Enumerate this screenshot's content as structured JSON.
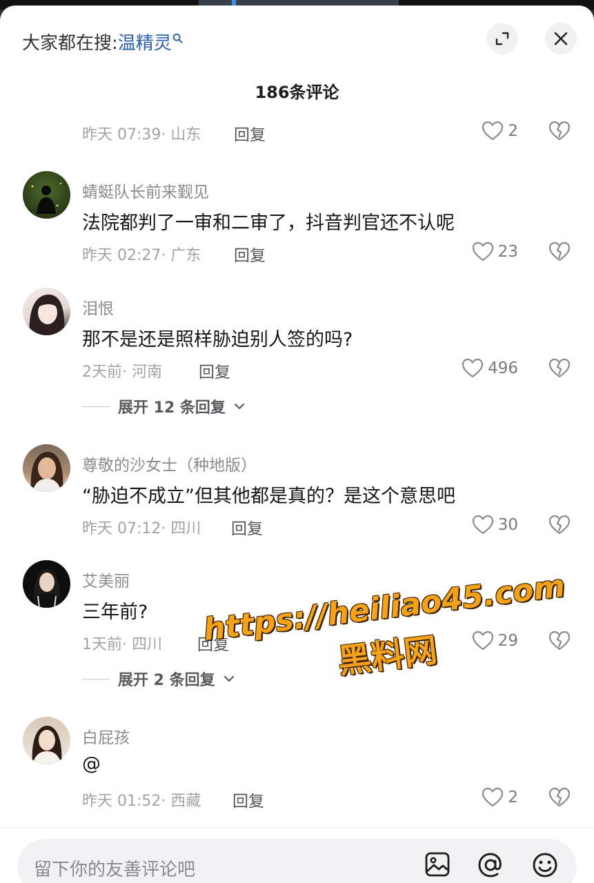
{
  "header": {
    "search_prefix": "大家都在搜:",
    "search_term": "温精灵",
    "comment_count": "186条评论"
  },
  "comments": [
    {
      "username": "",
      "text": "",
      "time": "昨天 07:39",
      "location": "· 山东",
      "reply_label": "回复",
      "likes": "2"
    },
    {
      "username": "蜻蜓队长前来觐见",
      "text": "法院都判了一审和二审了，抖音判官还不认呢",
      "time": "昨天 02:27",
      "location": "· 广东",
      "reply_label": "回复",
      "likes": "23"
    },
    {
      "username": "泪恨",
      "text": "那不是还是照样胁迫别人签的吗?",
      "time": "2天前",
      "location": "· 河南",
      "reply_label": "回复",
      "likes": "496",
      "expand_label": "展开 12 条回复"
    },
    {
      "username": "尊敬的沙女士（种地版）",
      "text": "“胁迫不成立”但其他都是真的？是这个意思吧",
      "time": "昨天 07:12",
      "location": "· 四川",
      "reply_label": "回复",
      "likes": "30"
    },
    {
      "username": "艾美丽",
      "text": "三年前?",
      "time": "1天前",
      "location": "· 四川",
      "reply_label": "回复",
      "likes": "29",
      "expand_label": "展开 2 条回复"
    },
    {
      "username": "白屁孩",
      "text": "@",
      "time": "昨天 01:52",
      "location": "· 西藏",
      "reply_label": "回复",
      "likes": "2"
    }
  ],
  "input": {
    "placeholder": "留下你的友善评论吧"
  },
  "watermark": {
    "url": "https://heiliao45.com",
    "site_name": "黑料网"
  },
  "icons": {
    "search": "search-icon",
    "expand": "expand-icon",
    "close": "close-icon",
    "like": "heart-icon",
    "dislike": "broken-heart-icon",
    "image": "image-icon",
    "mention": "at-icon",
    "emoji": "emoji-icon"
  },
  "colors": {
    "search_term": "#2a5ea8",
    "watermark": "#f3a21a"
  }
}
